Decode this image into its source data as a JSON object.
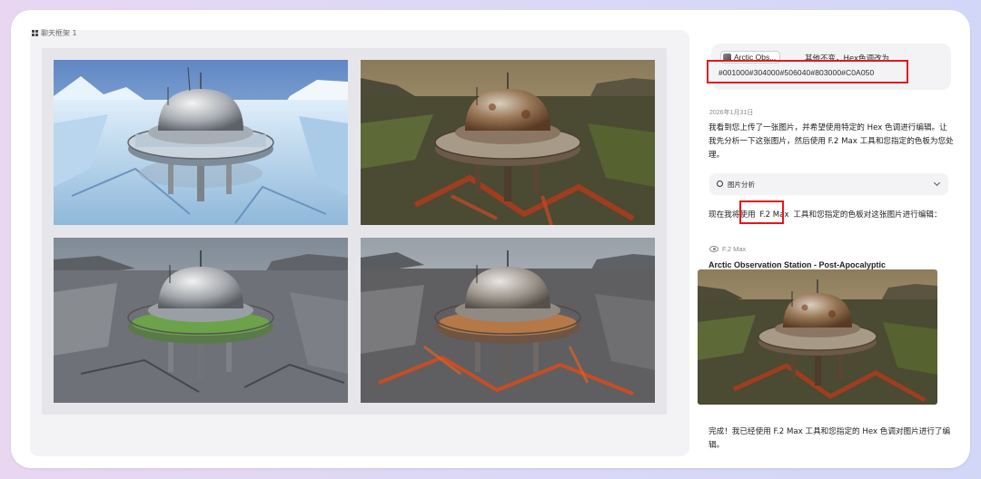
{
  "canvas": {
    "label": "聊天框架 1",
    "images": [
      {
        "name": "arctic-station-original",
        "scene": "ice"
      },
      {
        "name": "station-post-apocalyptic-rusted",
        "scene": "wasteland"
      },
      {
        "name": "station-rocky-green-glow",
        "scene": "rock-green"
      },
      {
        "name": "station-rocky-lava-glow",
        "scene": "rock-lava"
      }
    ]
  },
  "chat": {
    "user_message": {
      "ref_chip": "Arctic Obs...",
      "text": "其他不变，Hex色调改为",
      "hex": "#001000#304000#506040#803000#C0A050"
    },
    "date": "2026年1月31日",
    "assistant_intro": "我看到您上传了一张图片，并希望使用特定的 Hex 色调进行编辑。让我先分析一下这张图片，然后使用 F.2 Max 工具和您指定的色板为您处理。",
    "analysis_label": "图片分析",
    "edit_intro_prefix": "现在我将使用",
    "edit_intro_model": "F.2 Max",
    "edit_intro_suffix": "工具和您指定的色板对这张图片进行编辑：",
    "model_tag": "F.2 Max",
    "result_title": "Arctic Observation Station - Post-Apocalyptic",
    "completion": "完成！我已经使用 F.2 Max 工具和您指定的 Hex 色调对图片进行了编辑。"
  },
  "colors": {
    "highlight": "#e5161d",
    "panel_bg": "#f3f3f5",
    "palette": [
      "#001000",
      "#304000",
      "#506040",
      "#803000",
      "#C0A050"
    ]
  }
}
